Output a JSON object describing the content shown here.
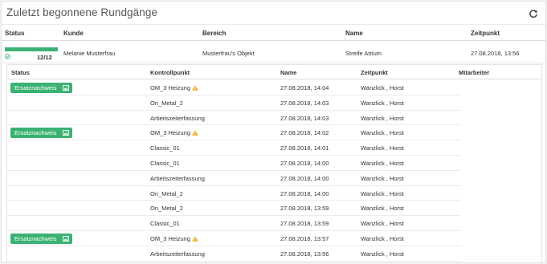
{
  "panel": {
    "title": "Zuletzt begonnene Rundgänge"
  },
  "outer_table": {
    "columns": [
      "Status",
      "Kunde",
      "Bereich",
      "Name",
      "Zeitpunkt"
    ],
    "row": {
      "progress": 1.0,
      "count": "12/12",
      "kunde": "Melanie Musterfrau",
      "bereich": "Musterfrau's Objekt",
      "name": "Streife Atrium",
      "zeitpunkt": "27.08.2018, 13:56"
    }
  },
  "inner_table": {
    "columns": [
      "Status",
      "Kontrollpunkt",
      "Name",
      "Zeitpunkt",
      "Mitarbeiter"
    ],
    "badge_label": "Ersatznachweis",
    "rows": [
      {
        "badge": true,
        "kontrollpunkt": "OM_3 Heizung",
        "warning": true,
        "name": "27.08.2018, 14:04",
        "zeitpunkt": "Wanzlick , Horst"
      },
      {
        "badge": false,
        "kontrollpunkt": "On_Metal_2",
        "warning": false,
        "name": "27.08.2018, 14:03",
        "zeitpunkt": "Wanzlick , Horst"
      },
      {
        "badge": false,
        "kontrollpunkt": "Arbeitszeiterfassung",
        "warning": false,
        "name": "27.08.2018, 14:03",
        "zeitpunkt": "Wanzlick , Horst"
      },
      {
        "badge": true,
        "kontrollpunkt": "OM_3 Heizung",
        "warning": true,
        "name": "27.08.2018, 14:02",
        "zeitpunkt": "Wanzlick , Horst"
      },
      {
        "badge": false,
        "kontrollpunkt": "Classic_01",
        "warning": false,
        "name": "27.08.2018, 14:01",
        "zeitpunkt": "Wanzlick , Horst"
      },
      {
        "badge": false,
        "kontrollpunkt": "Classic_01",
        "warning": false,
        "name": "27.08.2018, 14:00",
        "zeitpunkt": "Wanzlick , Horst"
      },
      {
        "badge": false,
        "kontrollpunkt": "Arbeitszeiterfassung",
        "warning": false,
        "name": "27.08.2018, 14:00",
        "zeitpunkt": "Wanzlick , Horst"
      },
      {
        "badge": false,
        "kontrollpunkt": "On_Metal_2",
        "warning": false,
        "name": "27.08.2018, 14:00",
        "zeitpunkt": "Wanzlick , Horst"
      },
      {
        "badge": false,
        "kontrollpunkt": "On_Metal_2",
        "warning": false,
        "name": "27.08.2018, 13:59",
        "zeitpunkt": "Wanzlick , Horst"
      },
      {
        "badge": false,
        "kontrollpunkt": "Classic_01",
        "warning": false,
        "name": "27.08.2018, 13:59",
        "zeitpunkt": "Wanzlick , Horst"
      },
      {
        "badge": true,
        "kontrollpunkt": "OM_3 Heizung",
        "warning": true,
        "name": "27.08.2018, 13:57",
        "zeitpunkt": "Wanzlick , Horst"
      },
      {
        "badge": false,
        "kontrollpunkt": "Arbeitszeiterfassung",
        "warning": false,
        "name": "27.08.2018, 13:56",
        "zeitpunkt": "Wanzlick , Horst"
      }
    ]
  },
  "icons": {
    "refresh": "refresh-icon",
    "check": "check-circle-icon",
    "badge_image": "image-icon",
    "warning": "warning-icon"
  },
  "colors": {
    "accent_green": "#3bb273",
    "warning": "#f0ad1e",
    "border": "#e4e4e4"
  }
}
